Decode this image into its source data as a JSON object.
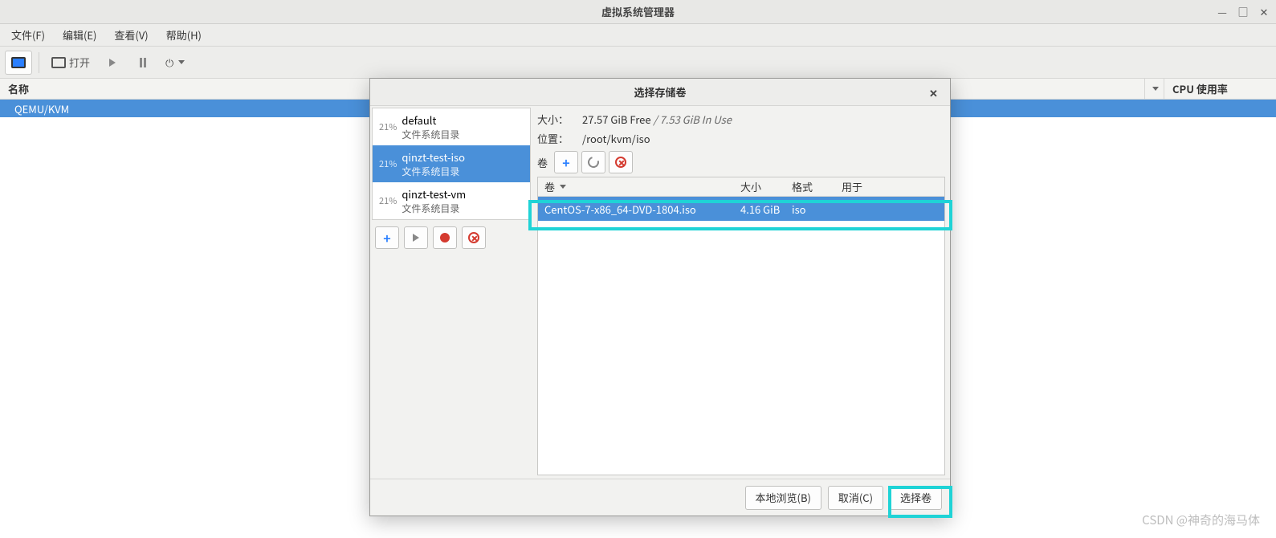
{
  "window": {
    "title": "虚拟系统管理器",
    "menu": {
      "file": "文件(F)",
      "edit": "编辑(E)",
      "view": "查看(V)",
      "help": "帮助(H)"
    },
    "toolbar": {
      "open": "打开"
    },
    "columns": {
      "name": "名称",
      "cpu": "CPU 使用率"
    },
    "connections": [
      {
        "name": "QEMU/KVM"
      }
    ]
  },
  "dialog": {
    "title": "选择存储卷",
    "pools": [
      {
        "pct": "21%",
        "name": "default",
        "type": "文件系统目录",
        "selected": false
      },
      {
        "pct": "21%",
        "name": "qinzt-test-iso",
        "type": "文件系统目录",
        "selected": true
      },
      {
        "pct": "21%",
        "name": "qinzt-test-vm",
        "type": "文件系统目录",
        "selected": false
      }
    ],
    "info": {
      "size_label": "大小：",
      "size_value": "27.57 GiB Free",
      "size_in_use": " / 7.53 GiB In Use",
      "loc_label": "位置：",
      "loc_value": "/root/kvm/iso",
      "vol_label": "卷"
    },
    "vol_headers": {
      "c1": "卷",
      "c2": "大小",
      "c3": "格式",
      "c4": "用于"
    },
    "volumes": [
      {
        "name": "CentOS-7-x86_64-DVD-1804.iso",
        "size": "4.16 GiB",
        "format": "iso",
        "used": ""
      }
    ],
    "buttons": {
      "browse": "本地浏览(B)",
      "cancel": "取消(C)",
      "choose": "选择卷"
    }
  },
  "watermark": "CSDN @神奇的海马体"
}
